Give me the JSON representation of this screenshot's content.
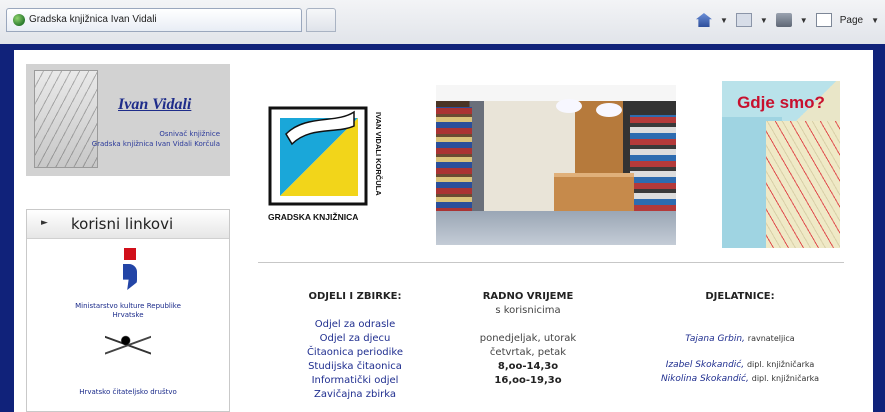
{
  "browser": {
    "tab_title": "Gradska knjižnica Ivan Vidali",
    "toolbar": {
      "page_label": "Page"
    }
  },
  "brand": {
    "title": "Ivan Vidali",
    "sub1": "Osnivač knjižnice",
    "sub2": "Gradska knjižnica Ivan Vidali Korčula"
  },
  "links": {
    "title": "korisni linkovi",
    "ministry_label_1": "Ministarstvo kulture Republike",
    "ministry_label_2": "Hrvatske",
    "reading_society_label": "Hrvatsko čitateljsko društvo"
  },
  "library_logo": {
    "bottom_text": "GRADSKA KNJIŽNICA",
    "side_text": "IVAN VIDALI KORČULA"
  },
  "map": {
    "title": "Gdje smo?"
  },
  "columns": {
    "departments": {
      "heading": "ODJELI I ZBIRKE:",
      "items": [
        "Odjel za odrasle",
        "Odjel za djecu",
        "Čitaonica periodike",
        "Studijska čitaonica",
        "Informatički odjel",
        "Zavičajna zbirka"
      ]
    },
    "hours": {
      "heading": "RADNO VRIJEME",
      "sub": "s korisnicima",
      "days_1": "ponedjeljak, utorak",
      "days_2": "četvrtak, petak",
      "time_1": "8,oo-14,3o",
      "time_2": "16,oo-19,3o"
    },
    "staff": {
      "heading": "DJELATNICE:",
      "p1_name": "Tajana Grbin,",
      "p1_role": "ravnateljica",
      "p2_name": "Izabel Skokandić,",
      "p2_role": "dipl. knjižničarka",
      "p3_name": "Nikolina Skokandić,",
      "p3_role": "dipl. knjižničarka"
    }
  }
}
